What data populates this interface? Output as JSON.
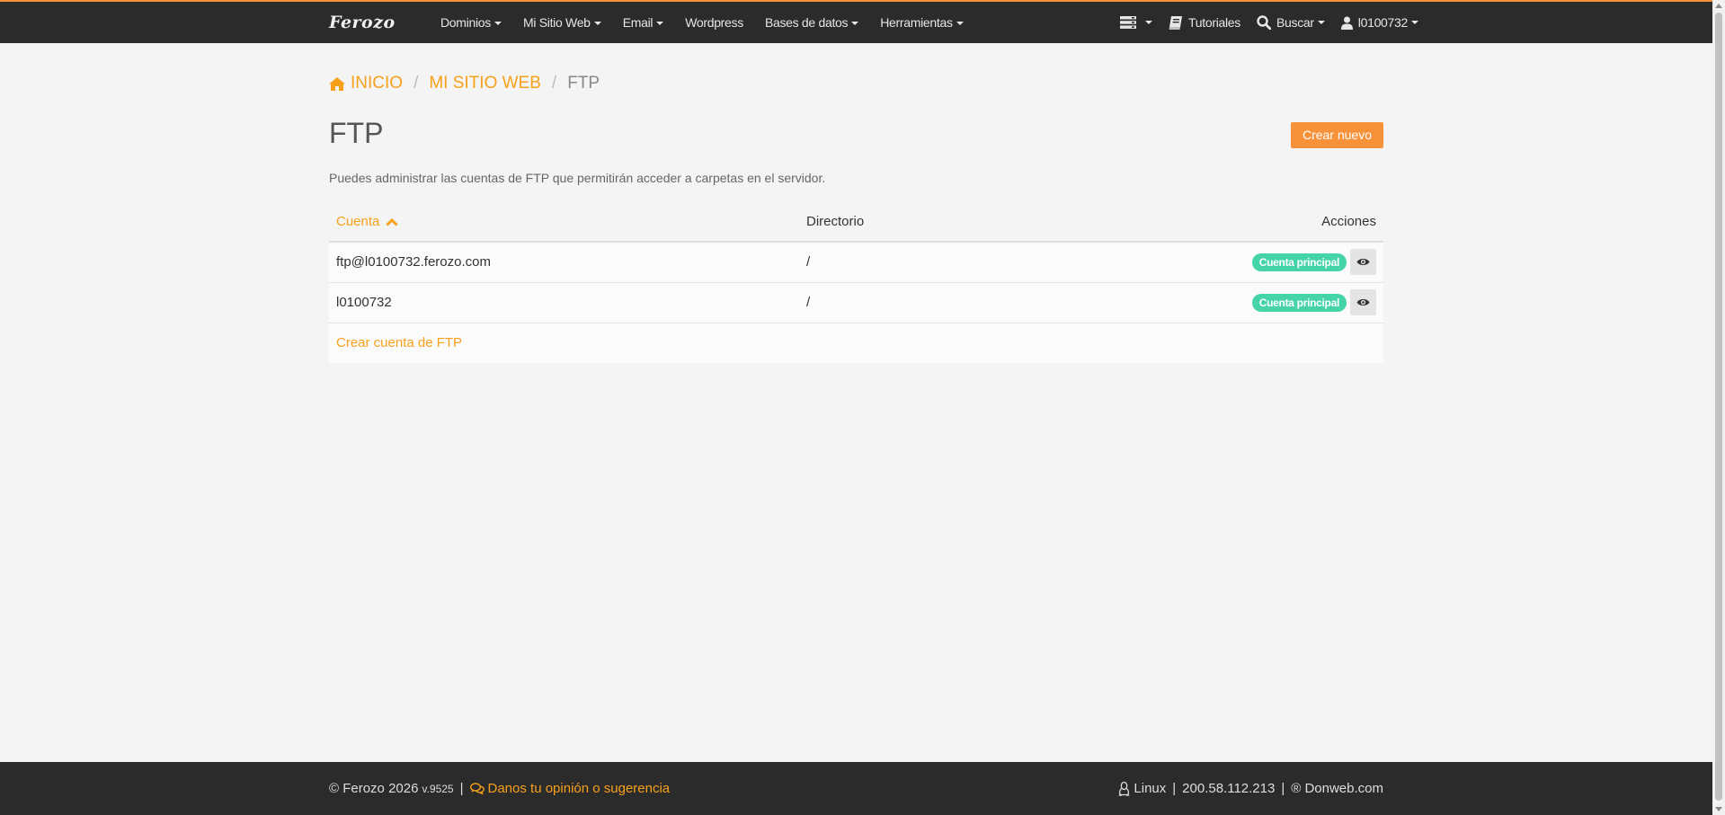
{
  "nav": {
    "brand": "Ferozo",
    "menu": [
      {
        "label": "Dominios"
      },
      {
        "label": "Mi Sitio Web"
      },
      {
        "label": "Email"
      },
      {
        "label": "Wordpress"
      },
      {
        "label": "Bases de datos"
      },
      {
        "label": "Herramientas"
      }
    ],
    "tutorials": "Tutoriales",
    "search": "Buscar",
    "user": "l0100732"
  },
  "breadcrumb": {
    "home": "INICIO",
    "section": "MI SITIO WEB",
    "current": "FTP",
    "separator": "/"
  },
  "page": {
    "title": "FTP",
    "create_button": "Crear nuevo",
    "description": "Puedes administrar las cuentas de FTP que permitirán acceder a carpetas en el servidor."
  },
  "table": {
    "columns": {
      "account": "Cuenta",
      "directory": "Directorio",
      "actions": "Acciones"
    },
    "rows": [
      {
        "account": "ftp@l0100732.ferozo.com",
        "directory": "/",
        "badge": "Cuenta principal"
      },
      {
        "account": "l0100732",
        "directory": "/",
        "badge": "Cuenta principal"
      }
    ],
    "create_link": "Crear cuenta de FTP"
  },
  "footer": {
    "copyright": "© Ferozo 2026",
    "version": "v.9525",
    "separator": "|",
    "feedback": "Danos tu opinión o sugerencia",
    "os": "Linux",
    "ip": "200.58.112.213",
    "provider": "® Donweb.com"
  },
  "colors": {
    "accent": "#f7923a",
    "link": "#f7a11a",
    "navbar": "#2b2b2b",
    "badge": "#45d4a8"
  },
  "icons": [
    "home-icon",
    "server-icon",
    "book-icon",
    "search-icon",
    "user-icon",
    "chevron-up-icon",
    "eye-icon",
    "comments-icon",
    "linux-icon"
  ]
}
